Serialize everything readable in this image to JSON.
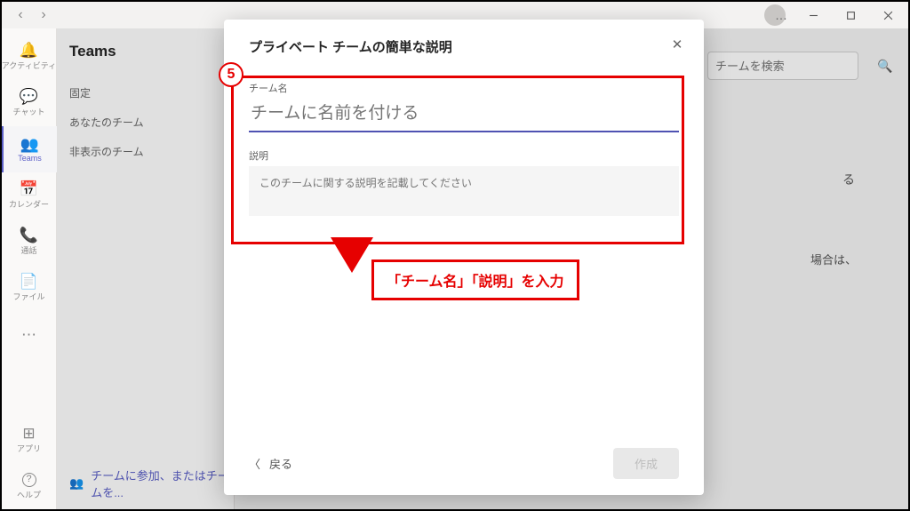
{
  "titlebar": {
    "more_icon": "…"
  },
  "nav": {
    "back_glyph": "‹",
    "fwd_glyph": "›"
  },
  "rail": {
    "items": [
      {
        "icon": "🔔",
        "label": "アクティビティ",
        "name": "rail-activity"
      },
      {
        "icon": "💬",
        "label": "チャット",
        "name": "rail-chat"
      },
      {
        "icon": "👥",
        "label": "Teams",
        "name": "rail-teams"
      },
      {
        "icon": "📅",
        "label": "カレンダー",
        "name": "rail-calendar"
      },
      {
        "icon": "📞",
        "label": "通話",
        "name": "rail-calls"
      },
      {
        "icon": "📄",
        "label": "ファイル",
        "name": "rail-files"
      }
    ],
    "apps": {
      "icon": "⊞",
      "label": "アプリ"
    },
    "help": {
      "icon": "?",
      "label": "ヘルプ"
    }
  },
  "teamspane": {
    "title": "Teams",
    "sections": [
      "固定",
      "あなたのチーム",
      "非表示のチーム"
    ],
    "join_label": "チームに参加、またはチームを..."
  },
  "main": {
    "search_placeholder": "チームを検索",
    "hint1_suffix": "る",
    "hint2_suffix": "場合は、"
  },
  "modal": {
    "title": "プライベート チームの簡単な説明",
    "team_name_label": "チーム名",
    "team_name_placeholder": "チームに名前を付ける",
    "desc_label": "説明",
    "desc_placeholder": "このチームに関する説明を記載してください",
    "back": "戻る",
    "create": "作成"
  },
  "annotation": {
    "step": "5",
    "callout": "「チーム名」「説明」を入力"
  }
}
